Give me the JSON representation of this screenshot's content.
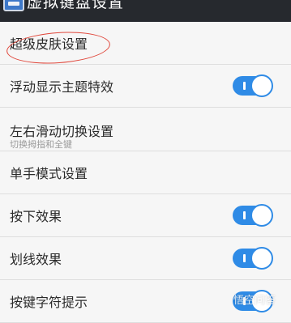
{
  "header": {
    "title": "虚拟键盘设置",
    "app_icon": "keyboard-settings-icon"
  },
  "settings": {
    "items": [
      {
        "label": "超级皮肤设置"
      },
      {
        "label": "浮动显示主题特效",
        "toggle": "on"
      },
      {
        "label": "左右滑动切换设置",
        "sublabel": "切换拇指和全键"
      },
      {
        "label": "单手模式设置"
      },
      {
        "label": "按下效果",
        "toggle": "on"
      },
      {
        "label": "划线效果",
        "toggle": "on"
      },
      {
        "label": "按键字符提示",
        "toggle": "on"
      }
    ]
  },
  "overlay": {
    "watermark": "悟空问答",
    "annotation_color": "#e0463a"
  },
  "colors": {
    "accent": "#2f8be6",
    "topbar": "#26292e",
    "background": "#f6f6f6"
  }
}
